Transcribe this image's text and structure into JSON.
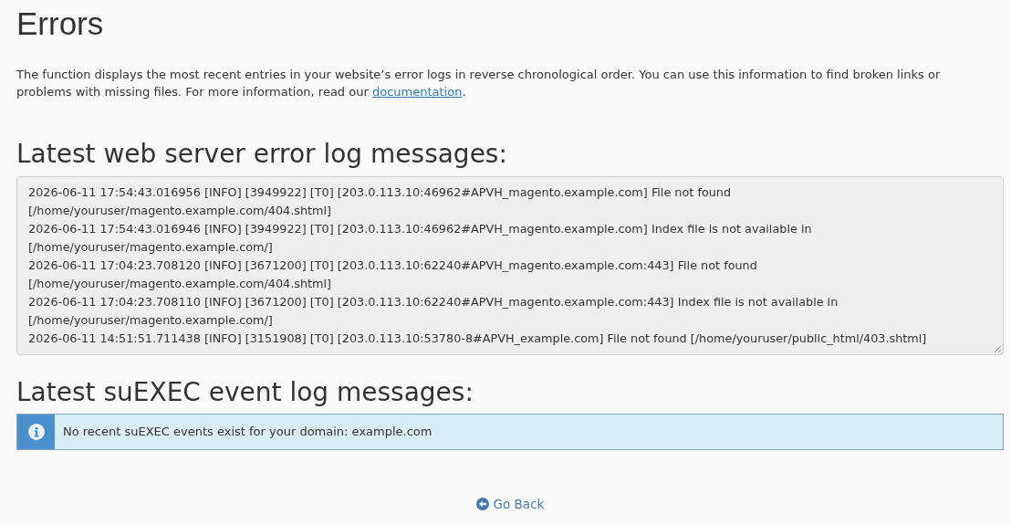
{
  "page": {
    "title": "Errors"
  },
  "intro": {
    "text": "The function displays the most recent entries in your website’s error logs in reverse chronological order. You can use this information to find broken links or problems with missing files. For more information, read our ",
    "link": "documentation",
    "after": "."
  },
  "error_log": {
    "heading": "Latest web server error log messages:",
    "entries": [
      "2026-06-11 17:54:43.016956 [INFO] [3949922] [T0] [203.0.113.10:46962#APVH_magento.example.com] File not found [/home/youruser/magento.example.com/404.shtml]",
      "2026-06-11 17:54:43.016946 [INFO] [3949922] [T0] [203.0.113.10:46962#APVH_magento.example.com] Index file is not available in [/home/youruser/magento.example.com/]",
      "2026-06-11 17:04:23.708120 [INFO] [3671200] [T0] [203.0.113.10:62240#APVH_magento.example.com:443] File not found [/home/youruser/magento.example.com/404.shtml]",
      "2026-06-11 17:04:23.708110 [INFO] [3671200] [T0] [203.0.113.10:62240#APVH_magento.example.com:443] Index file is not available in [/home/youruser/magento.example.com/]",
      "2026-06-11 14:51:51.711438 [INFO] [3151908] [T0] [203.0.113.10:53780-8#APVH_example.com] File not found [/home/youruser/public_html/403.shtml]"
    ]
  },
  "suexec_log": {
    "heading": "Latest suEXEC event log messages:",
    "alert": {
      "kind": "info",
      "message": "No recent suEXEC events exist for your domain: example.com"
    }
  },
  "go_back": {
    "label": "Go Back"
  }
}
